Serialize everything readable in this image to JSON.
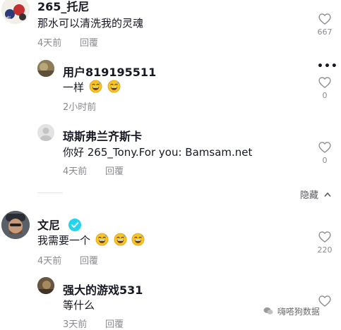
{
  "comments": [
    {
      "user": "265_托尼",
      "text": "那水可以清洗我的灵魂",
      "time": "4天前",
      "reply": "回覆",
      "likes": "667"
    },
    {
      "user": "用户819195511",
      "text": "一样",
      "emojis": [
        "grinning-sweat-emoji",
        "grinning-sweat-emoji"
      ],
      "time": "2小时前",
      "likes": "0",
      "more": "•••"
    },
    {
      "user": "琼斯弗兰齐斯卡",
      "text": "你好 265_Tony.For you: Bamsam.net",
      "time": "4天前",
      "reply": "回覆",
      "likes": "0"
    },
    {
      "user": "文尼",
      "verified": true,
      "text": "我需要一个",
      "emojis": [
        "grinning-sweat-emoji",
        "grinning-sweat-emoji",
        "grinning-sweat-emoji"
      ],
      "time": "4天前",
      "reply": "回覆",
      "likes": "220"
    },
    {
      "user": "强大的游戏531",
      "text": "等什么",
      "time": "3天前",
      "reply": "回覆"
    }
  ],
  "hide_replies": "隐藏",
  "watermark": "嗨嗒狗数据",
  "colors": {
    "accent": "#20d5ec",
    "text": "#161823",
    "muted": "#8a8b91"
  }
}
